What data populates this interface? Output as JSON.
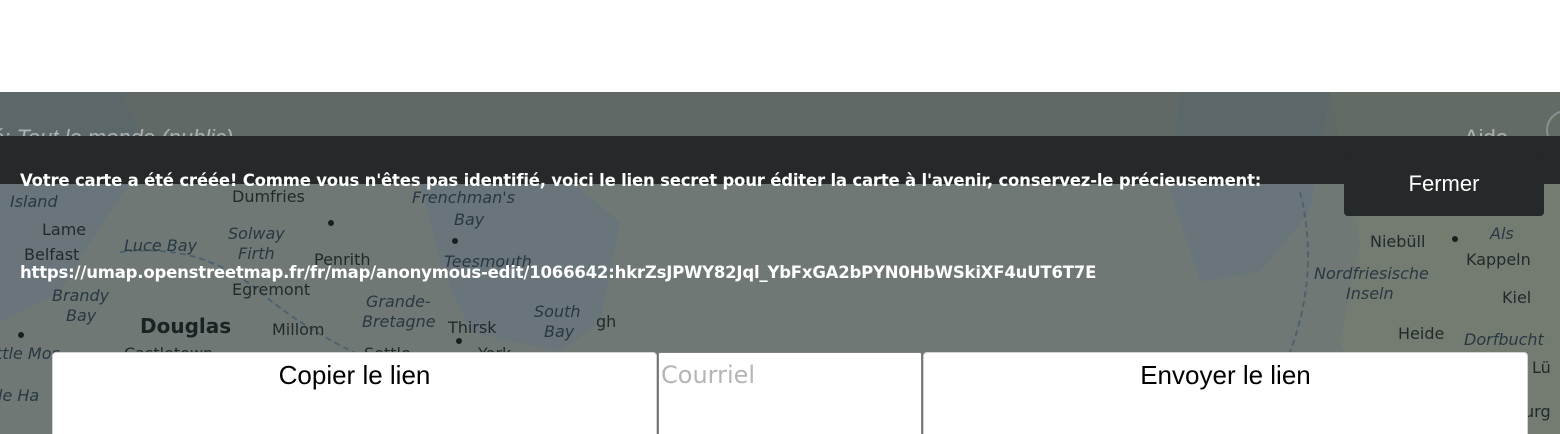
{
  "header": {
    "share_status": "é: Tout le monde (public)",
    "help_label": "Aide"
  },
  "map": {
    "labels": {
      "island": "Island",
      "lame": "Lame",
      "belfast": "Belfast",
      "luce_bay": "Luce Bay",
      "brandy_bay": "Brandy",
      "bay": "Bay",
      "douglas": "Douglas",
      "millom": "Millom",
      "dumfries": "Dumfries",
      "solway_firth": "Solway",
      "firth": "Firth",
      "penrith": "Penrith",
      "egremont": "Egremont",
      "grande_bretagne": "Grande-",
      "bretagne": "Bretagne",
      "thirsk": "Thirsk",
      "frenchmans_bay": "Frenchman's",
      "frenchmans_bay_2": "Bay",
      "teesmouth": "Teesmouth",
      "south_bay": "South",
      "south_bay_2": "Bay",
      "gh": "gh",
      "castletown": "Castletown",
      "settle": "Settle",
      "york": "York",
      "niebull": "Niebüll",
      "als": "Als",
      "kappeln": "Kappeln",
      "nordfriesische": "Nordfriesische",
      "inseln": "Inseln",
      "kiel": "Kiel",
      "heide": "Heide",
      "dorfbucht": "Dorfbucht",
      "lu": "Lü",
      "urg": "urg",
      "ttle_mos": "ttle Mos",
      "le_ha": "le Ha",
      "bay_upper": "Bay"
    }
  },
  "alert": {
    "message": "Votre carte a été créée! Comme vous n'êtes pas identifié, voici le lien secret pour éditer la carte à l'avenir, conservez-le précieusement:",
    "secret_link": "https://umap.openstreetmap.fr/fr/map/anonymous-edit/1066642:hkrZsJPWY82Jql_YbFxGA2bPYN0HbWSkiXF4uUT6T7E",
    "close_label": "Fermer"
  },
  "actions": {
    "copy_label": "Copier le lien",
    "email_placeholder": "Courriel",
    "email_value": "",
    "send_label": "Envoyer le lien"
  },
  "colors": {
    "alert_bg": "#25292a",
    "map_overlay": "#3f4748",
    "button_bg": "#ffffff"
  }
}
